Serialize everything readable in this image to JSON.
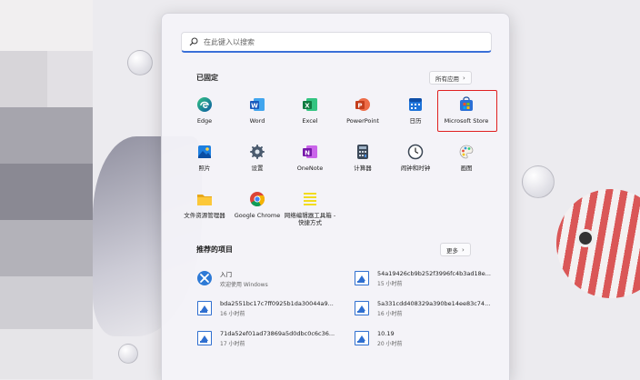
{
  "search": {
    "placeholder": "在此键入以搜索"
  },
  "pinned": {
    "title": "已固定",
    "all_apps_label": "所有应用",
    "apps": [
      {
        "label": "Edge",
        "icon": "edge-icon"
      },
      {
        "label": "Word",
        "icon": "word-icon"
      },
      {
        "label": "Excel",
        "icon": "excel-icon"
      },
      {
        "label": "PowerPoint",
        "icon": "powerpoint-icon"
      },
      {
        "label": "日历",
        "icon": "calendar-icon"
      },
      {
        "label": "Microsoft Store",
        "icon": "store-icon"
      },
      {
        "label": "照片",
        "icon": "photos-icon"
      },
      {
        "label": "设置",
        "icon": "settings-gear-icon"
      },
      {
        "label": "OneNote",
        "icon": "onenote-icon"
      },
      {
        "label": "计算器",
        "icon": "calculator-icon"
      },
      {
        "label": "闹钟和时钟",
        "icon": "clock-icon"
      },
      {
        "label": "画图",
        "icon": "paint-icon"
      },
      {
        "label": "文件资源管理器",
        "icon": "folder-icon"
      },
      {
        "label": "Google Chrome",
        "icon": "chrome-icon"
      },
      {
        "label": "网络编辑器工具箱 - 快捷方式",
        "icon": "shortcut-icon"
      }
    ]
  },
  "recommended": {
    "title": "推荐的项目",
    "more_label": "更多",
    "items": [
      {
        "name": "入门",
        "time": "欢迎使用 Windows",
        "icon": "get-started-icon"
      },
      {
        "name": "54a19426cb9b252f3996fc4b3ad18e...",
        "time": "15 小时前",
        "icon": "image-file-icon"
      },
      {
        "name": "bda2551bc17c7ff0925b1da30044a9...",
        "time": "16 小时前",
        "icon": "image-file-icon"
      },
      {
        "name": "5a331cdd408329a390be14ee83c74...",
        "time": "16 小时前",
        "icon": "image-file-icon"
      },
      {
        "name": "71da52ef01ad73869a5d0dbc0c6c36...",
        "time": "17 小时前",
        "icon": "image-file-icon"
      },
      {
        "name": "10.19",
        "time": "20 小时前",
        "icon": "image-file-icon"
      }
    ]
  },
  "colors": {
    "accent": "#3a6fd8",
    "highlight": "#e02020"
  }
}
